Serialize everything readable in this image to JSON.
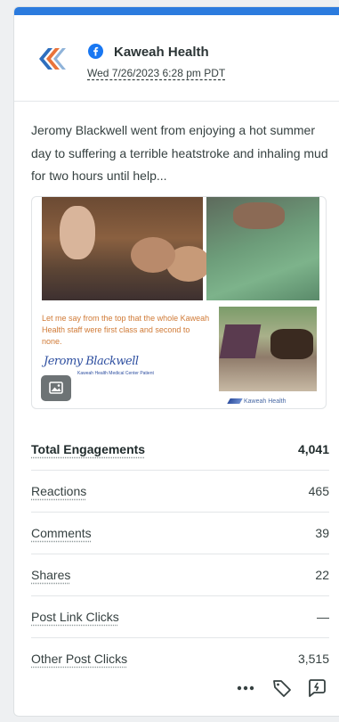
{
  "post": {
    "network_icon": "facebook-icon",
    "page_name": "Kaweah Health",
    "date": "Wed 7/26/2023 6:28 pm PDT",
    "text": "Jeromy Blackwell went from enjoying a hot summer day to suffering a terrible heatstroke and inhaling mud for two hours until help...",
    "media": {
      "quote": "Let me say from the top that the whole Kaweah Health staff were first class and second to none.",
      "signature": "Jeromy Blackwell",
      "signature_sub": "Kaweah Health Medical Center Patient",
      "logo_text": "Kaweah Health",
      "badge_icon": "image-icon"
    }
  },
  "metrics": [
    {
      "label": "Total Engagements",
      "value": "4,041"
    },
    {
      "label": "Reactions",
      "value": "465"
    },
    {
      "label": "Comments",
      "value": "39"
    },
    {
      "label": "Shares",
      "value": "22"
    },
    {
      "label": "Post Link Clicks",
      "value": "—"
    },
    {
      "label": "Other Post Clicks",
      "value": "3,515"
    }
  ],
  "actions": [
    "more-icon",
    "tag-icon",
    "reply-icon"
  ],
  "colors": {
    "accent_bar": "#2b7bde",
    "facebook": "#1877f2",
    "text": "#364141"
  }
}
